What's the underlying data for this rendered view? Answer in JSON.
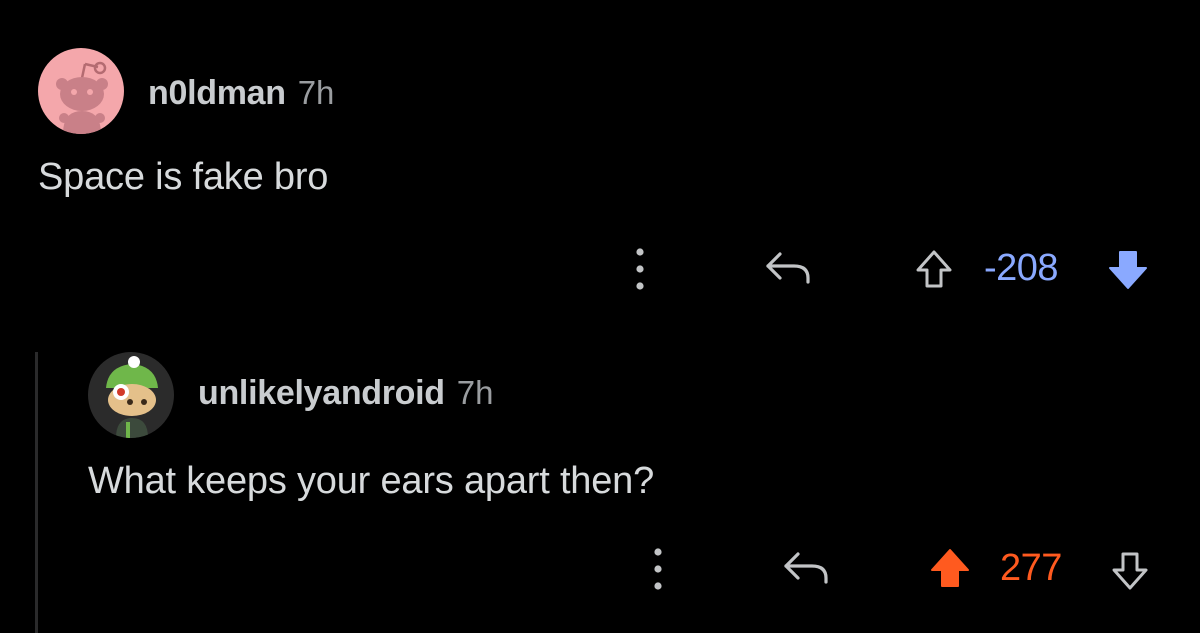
{
  "comments": [
    {
      "username": "n0ldman",
      "age": "7h",
      "text": "Space is fake bro",
      "score": "-208",
      "vote": "down",
      "score_color": "#8aa9ff",
      "avatar_icon": "reddit-snoo-avatar-icon"
    },
    {
      "username": "unlikelyandroid",
      "age": "7h",
      "text": "What keeps your ears apart then?",
      "score": "277",
      "vote": "up",
      "score_color": "#ff5a1f",
      "avatar_icon": "custom-snoo-avatar-icon"
    }
  ],
  "colors": {
    "background": "#000000",
    "icon_gray": "#c2c4c6",
    "upvote_orange": "#ff5a1f",
    "downvote_blue": "#8aa9ff"
  }
}
